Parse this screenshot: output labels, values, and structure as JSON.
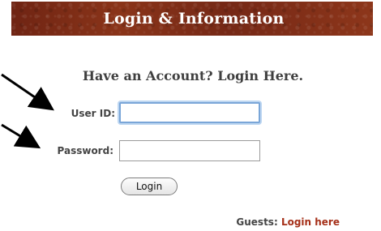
{
  "header": {
    "title": "Login & Information"
  },
  "login": {
    "heading": "Have an Account? Login Here.",
    "user_id_label": "User ID:",
    "user_id_value": "",
    "password_label": "Password:",
    "password_value": "",
    "button_label": "Login"
  },
  "guests": {
    "prefix": "Guests:",
    "link_label": "Login here"
  },
  "colors": {
    "banner": "#7a2a17",
    "link": "#a52f18",
    "focus_ring": "#7aa6d8"
  },
  "icons": {
    "arrow_1": "arrow-icon",
    "arrow_2": "arrow-icon"
  }
}
